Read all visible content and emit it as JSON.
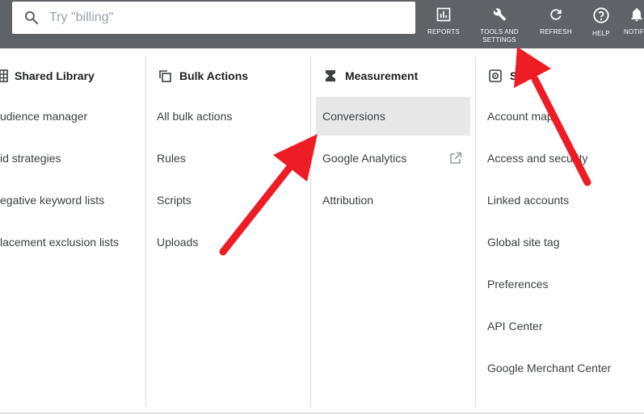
{
  "header": {
    "search": {
      "placeholder": "Try \"billing\"",
      "value": ""
    },
    "tools": [
      {
        "label": "REPORTS",
        "icon": "reports-icon"
      },
      {
        "label": "TOOLS AND SETTINGS",
        "icon": "wrench-icon"
      },
      {
        "label": "REFRESH",
        "icon": "refresh-icon"
      },
      {
        "label": "HELP",
        "icon": "help-icon"
      },
      {
        "label": "NOTIFI",
        "icon": "notifications-icon"
      }
    ]
  },
  "columns": [
    {
      "title": "Shared Library",
      "icon": "grid-icon",
      "items": [
        "udience manager",
        "id strategies",
        "egative keyword lists",
        "lacement exclusion lists"
      ]
    },
    {
      "title": "Bulk Actions",
      "icon": "copy-icon",
      "items": [
        "All bulk actions",
        "Rules",
        "Scripts",
        "Uploads"
      ]
    },
    {
      "title": "Measurement",
      "icon": "hourglass-icon",
      "items": [
        "Conversions",
        "Google Analytics",
        "Attribution"
      ],
      "selected": "Conversions",
      "external": "Google Analytics"
    },
    {
      "title": "S",
      "icon": "gear-icon",
      "items": [
        "Account map",
        "Access and security",
        "Linked accounts",
        "Global site tag",
        "Preferences",
        "API Center",
        "Google Merchant Center"
      ]
    }
  ],
  "colors": {
    "topbar": "#5f6368",
    "selected": "#e8e8e8",
    "arrow": "#ee1c24"
  }
}
